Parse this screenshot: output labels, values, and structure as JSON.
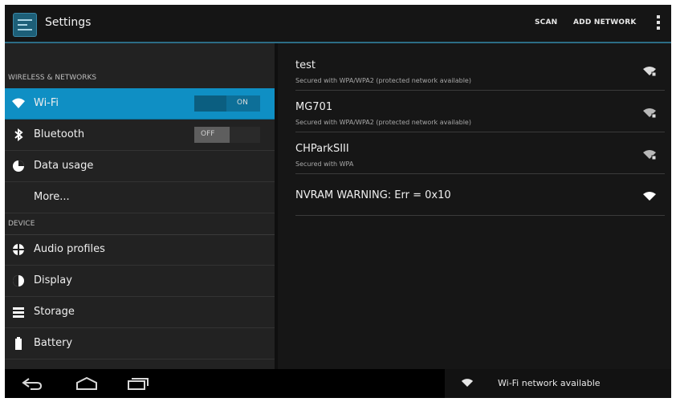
{
  "actionbar": {
    "title": "Settings",
    "scan_label": "SCAN",
    "add_network_label": "ADD NETWORK",
    "app_icon": "settings-icon"
  },
  "left_panel": {
    "sections": [
      {
        "header": "WIRELESS & NETWORKS",
        "items": [
          {
            "label": "Wi-Fi",
            "icon": "wifi-icon",
            "toggle": "ON",
            "selected": true
          },
          {
            "label": "Bluetooth",
            "icon": "bluetooth-icon",
            "toggle": "OFF"
          },
          {
            "label": "Data usage",
            "icon": "data-usage-icon"
          },
          {
            "label": "More..."
          }
        ]
      },
      {
        "header": "DEVICE",
        "items": [
          {
            "label": "Audio profiles",
            "icon": "audio-profiles-icon"
          },
          {
            "label": "Display",
            "icon": "display-icon"
          },
          {
            "label": "Storage",
            "icon": "storage-icon"
          },
          {
            "label": "Battery",
            "icon": "battery-icon"
          }
        ]
      }
    ]
  },
  "networks": [
    {
      "ssid": "test",
      "security": "Secured with WPA/WPA2 (protected network available)",
      "icon": "wifi-locked-icon"
    },
    {
      "ssid": "MG701",
      "security": "Secured with WPA/WPA2 (protected network available)",
      "icon": "wifi-locked-icon"
    },
    {
      "ssid": "CHParkSIII",
      "security": "Secured with WPA",
      "icon": "wifi-locked-icon"
    },
    {
      "ssid": "NVRAM WARNING: Err = 0x10",
      "security": "",
      "icon": "wifi-icon"
    }
  ],
  "notification": {
    "text": "Wi-Fi network available",
    "icon": "wifi-icon"
  },
  "colors": {
    "accent": "#0f8fc4",
    "action_bar_line": "#2c6d86"
  }
}
